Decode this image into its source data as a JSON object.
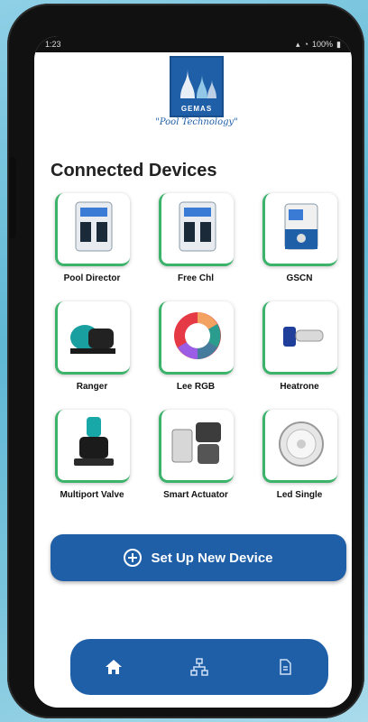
{
  "status": {
    "time": "1:23",
    "battery": "100%"
  },
  "brand": {
    "name": "GEMAS",
    "tagline": "\"Pool Technology\""
  },
  "page": {
    "title": "Connected Devices"
  },
  "devices": [
    {
      "label": "Pool Director",
      "icon": "control-panel-icon"
    },
    {
      "label": "Free Chl",
      "icon": "control-panel-icon"
    },
    {
      "label": "GSCN",
      "icon": "salt-chlorinator-icon"
    },
    {
      "label": "Ranger",
      "icon": "pump-icon"
    },
    {
      "label": "Lee RGB",
      "icon": "rgb-light-icon"
    },
    {
      "label": "Heatrone",
      "icon": "heater-icon"
    },
    {
      "label": "Multiport Valve",
      "icon": "valve-icon"
    },
    {
      "label": "Smart Actuator",
      "icon": "actuator-icon"
    },
    {
      "label": "Led Single",
      "icon": "led-light-icon"
    }
  ],
  "actions": {
    "setup_label": "Set Up New Device"
  },
  "nav": [
    {
      "name": "home",
      "icon": "home-icon",
      "active": true
    },
    {
      "name": "network",
      "icon": "network-icon",
      "active": false
    },
    {
      "name": "document",
      "icon": "document-icon",
      "active": false
    }
  ],
  "colors": {
    "primary": "#1f5fa8",
    "accent": "#3bb36a"
  }
}
